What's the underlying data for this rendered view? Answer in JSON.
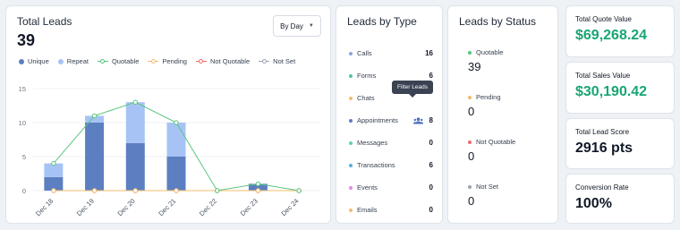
{
  "leads": {
    "title": "Total Leads",
    "total": "39",
    "dropdown_label": "By Day",
    "legend": [
      {
        "label": "Unique",
        "style": "dot",
        "color": "#5c7fc2"
      },
      {
        "label": "Repeat",
        "style": "dot",
        "color": "#a7c3f5"
      },
      {
        "label": "Quotable",
        "style": "line",
        "color": "#59c57d"
      },
      {
        "label": "Pending",
        "style": "line",
        "color": "#f3bc6e"
      },
      {
        "label": "Not Quotable",
        "style": "line",
        "color": "#ee6b6b"
      },
      {
        "label": "Not Set",
        "style": "line",
        "color": "#9aa3b0"
      }
    ]
  },
  "chart_data": {
    "type": "bar",
    "categories": [
      "Dec 18",
      "Dec 19",
      "Dec 20",
      "Dec 21",
      "Dec 22",
      "Dec 23",
      "Dec 24"
    ],
    "series": [
      {
        "name": "Unique",
        "type": "bar",
        "stack": "leads",
        "color": "#5c7fc2",
        "values": [
          2,
          10,
          7,
          5,
          0,
          1,
          0
        ]
      },
      {
        "name": "Repeat",
        "type": "bar",
        "stack": "leads",
        "color": "#a7c3f5",
        "values": [
          2,
          1,
          6,
          5,
          0,
          0,
          0
        ]
      },
      {
        "name": "Quotable",
        "type": "line",
        "color": "#59c57d",
        "values": [
          4,
          11,
          13,
          10,
          0,
          1,
          0
        ]
      },
      {
        "name": "Pending",
        "type": "line",
        "color": "#f3bc6e",
        "values": [
          0,
          0,
          0,
          0,
          0,
          0,
          0
        ]
      },
      {
        "name": "Not Quotable",
        "type": "line",
        "color": "#ee6b6b",
        "values": [
          0,
          0,
          0,
          0,
          0,
          0,
          0
        ]
      },
      {
        "name": "Not Set",
        "type": "line",
        "color": "#9aa3b0",
        "values": [
          0,
          0,
          0,
          0,
          0,
          0,
          0
        ]
      }
    ],
    "yticks": [
      0,
      5,
      10,
      15
    ],
    "ylim": [
      0,
      15
    ],
    "grid": true,
    "legend": "top-left"
  },
  "by_type": {
    "title": "Leads by Type",
    "tooltip": "Filter Leads",
    "items": [
      {
        "label": "Calls",
        "count": "16",
        "color": "#8da4e8"
      },
      {
        "label": "Forms",
        "count": "6",
        "color": "#54c1a6"
      },
      {
        "label": "Chats",
        "count": "",
        "color": "#f3bc6e"
      },
      {
        "label": "Appointments",
        "count": "8",
        "color": "#5c7fc2"
      },
      {
        "label": "Messages",
        "count": "0",
        "color": "#59d2b6"
      },
      {
        "label": "Transactions",
        "count": "6",
        "color": "#54aee6"
      },
      {
        "label": "Events",
        "count": "0",
        "color": "#e38be3"
      },
      {
        "label": "Emails",
        "count": "0",
        "color": "#f3bc6e"
      }
    ]
  },
  "by_status": {
    "title": "Leads by Status",
    "items": [
      {
        "label": "Quotable",
        "value": "39",
        "color": "#59c57d"
      },
      {
        "label": "Pending",
        "value": "0",
        "color": "#f3bc6e"
      },
      {
        "label": "Not Quotable",
        "value": "0",
        "color": "#ee6b6b"
      },
      {
        "label": "Not Set",
        "value": "0",
        "color": "#9aa3b0"
      }
    ]
  },
  "cards": [
    {
      "title": "Total Quote Value",
      "value": "$69,268.24",
      "accent": "#17a673"
    },
    {
      "title": "Total Sales Value",
      "value": "$30,190.42",
      "accent": "#17a673"
    },
    {
      "title": "Total Lead Score",
      "value": "2916 pts",
      "accent": "#111827"
    },
    {
      "title": "Conversion Rate",
      "value": "100%",
      "accent": "#111827"
    }
  ],
  "icons": {
    "user_group": "users-icon",
    "dropdown": "chevron-down-icon"
  }
}
